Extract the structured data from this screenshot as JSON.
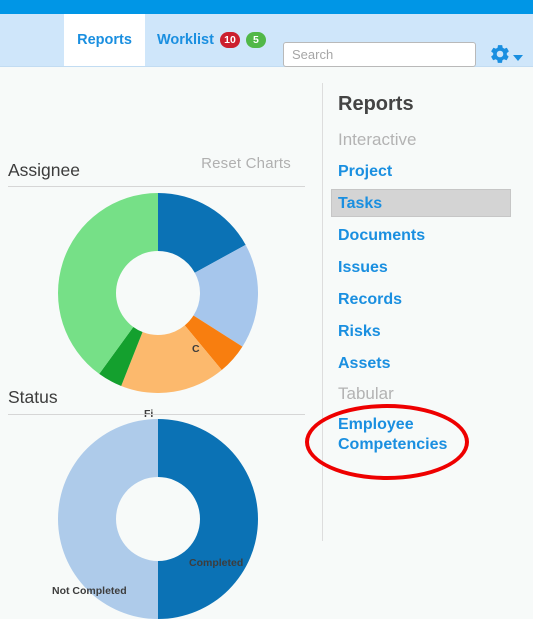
{
  "navbar": {
    "tabs": [
      {
        "label": "Reports",
        "active": true
      },
      {
        "label": "Worklist",
        "active": false
      }
    ],
    "worklist_badges": [
      {
        "value": "10",
        "color": "#cc1f2e"
      },
      {
        "value": "5",
        "color": "#51b848"
      }
    ],
    "search": {
      "value": "",
      "placeholder": "Search"
    },
    "settings_icon": "gear-icon",
    "caret_icon": "chevron-down-icon",
    "strip_color": "#0096e6",
    "bar_color": "#cfe6fa"
  },
  "toolbar": {
    "reset_charts_label": "Reset Charts"
  },
  "charts": [
    {
      "title": "Assignee",
      "labels_visible": [
        "C",
        "Fi"
      ]
    },
    {
      "title": "Status",
      "labels_visible": [
        "Completed",
        "Not Completed"
      ]
    }
  ],
  "chart_data": [
    {
      "type": "pie",
      "title": "Assignee",
      "donut": true,
      "inner_radius_ratio": 0.42,
      "start_angle": 0,
      "legend": "none",
      "categories": [
        "C",
        "(light blue)",
        "(orange)",
        "Fi",
        "(dark green)",
        "(light green)"
      ],
      "values": [
        17,
        17,
        5,
        17,
        4,
        40
      ],
      "labels": [
        "C",
        "",
        "",
        "Fi",
        "",
        ""
      ],
      "colors": [
        "#0b72b5",
        "#a6c6ec",
        "#f87e0f",
        "#fcb96d",
        "#14a02e",
        "#76e087"
      ]
    },
    {
      "type": "pie",
      "title": "Status",
      "donut": true,
      "inner_radius_ratio": 0.42,
      "start_angle": 0,
      "legend": "none",
      "categories": [
        "Completed",
        "Not Completed"
      ],
      "values": [
        50,
        50
      ],
      "labels": [
        "Completed",
        "Not Completed"
      ],
      "colors": [
        "#0b72b5",
        "#aecbea"
      ]
    }
  ],
  "sidebar": {
    "title": "Reports",
    "groups": [
      {
        "label": "Interactive",
        "items": [
          {
            "label": "Project",
            "selected": false
          },
          {
            "label": "Tasks",
            "selected": true
          },
          {
            "label": "Documents",
            "selected": false
          },
          {
            "label": "Issues",
            "selected": false
          },
          {
            "label": "Records",
            "selected": false
          },
          {
            "label": "Risks",
            "selected": false
          },
          {
            "label": "Assets",
            "selected": false
          }
        ]
      },
      {
        "label": "Tabular",
        "items": [
          {
            "label": "Employee Competencies",
            "selected": false,
            "annotated": true
          }
        ]
      }
    ]
  },
  "annotation": {
    "shape": "ellipse",
    "color": "#ee0000",
    "target": "Employee Competencies"
  }
}
